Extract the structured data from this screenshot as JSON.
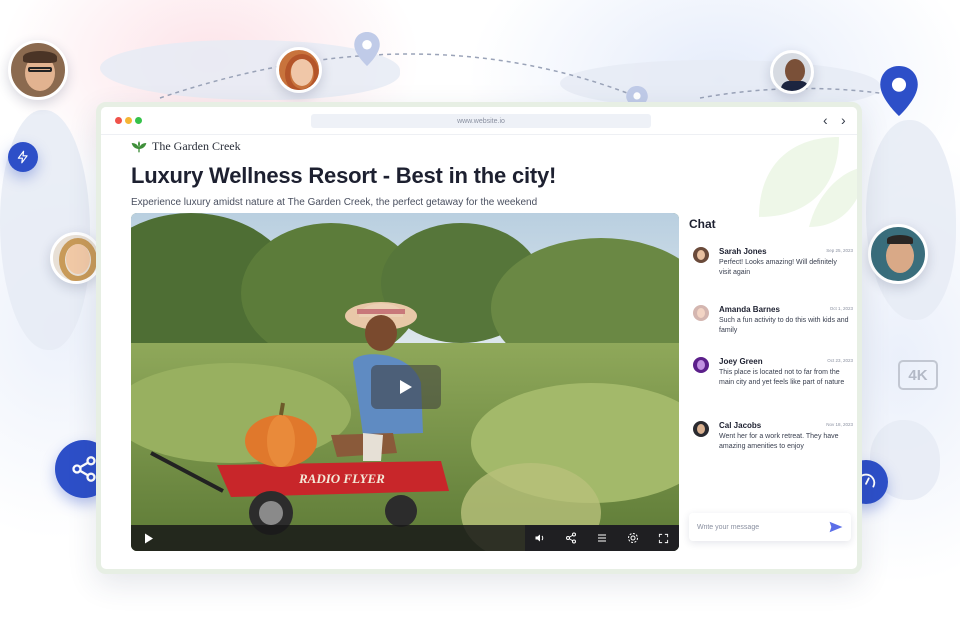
{
  "browser": {
    "url": "www.website.io",
    "back_glyph": "‹",
    "forward_glyph": "›"
  },
  "brand": {
    "name": "The Garden Creek",
    "accent": "#3f8f3a"
  },
  "page": {
    "title": "Luxury Wellness Resort - Best in the city!",
    "subtitle": "Experience luxury amidst nature at The Garden Creek, the perfect getaway for the weekend"
  },
  "video": {
    "controls": [
      "play-icon",
      "volume-icon",
      "share-icon",
      "playlist-icon",
      "settings-icon",
      "fullscreen-icon"
    ]
  },
  "chat": {
    "title": "Chat",
    "messages": [
      {
        "name": "Sarah Jones",
        "date": "Sep 25, 2023",
        "text": "Perfect! Looks amazing! Will definitely visit again"
      },
      {
        "name": "Amanda Barnes",
        "date": "Oct 1, 2023",
        "text": "Such a fun activity to do this with kids and family"
      },
      {
        "name": "Joey Green",
        "date": "Oct 23, 2023",
        "text": "This place is located not to far from the main city and yet feels like part of nature"
      },
      {
        "name": "Cal Jacobs",
        "date": "Nov 18, 2023",
        "text": "Went her for a work retreat. They have amazing amenities to enjoy"
      }
    ],
    "input_placeholder": "Write your message"
  },
  "badge": {
    "label": "4K"
  },
  "colors": {
    "primary": "#2d4fc8",
    "send": "#5b6ee8"
  }
}
